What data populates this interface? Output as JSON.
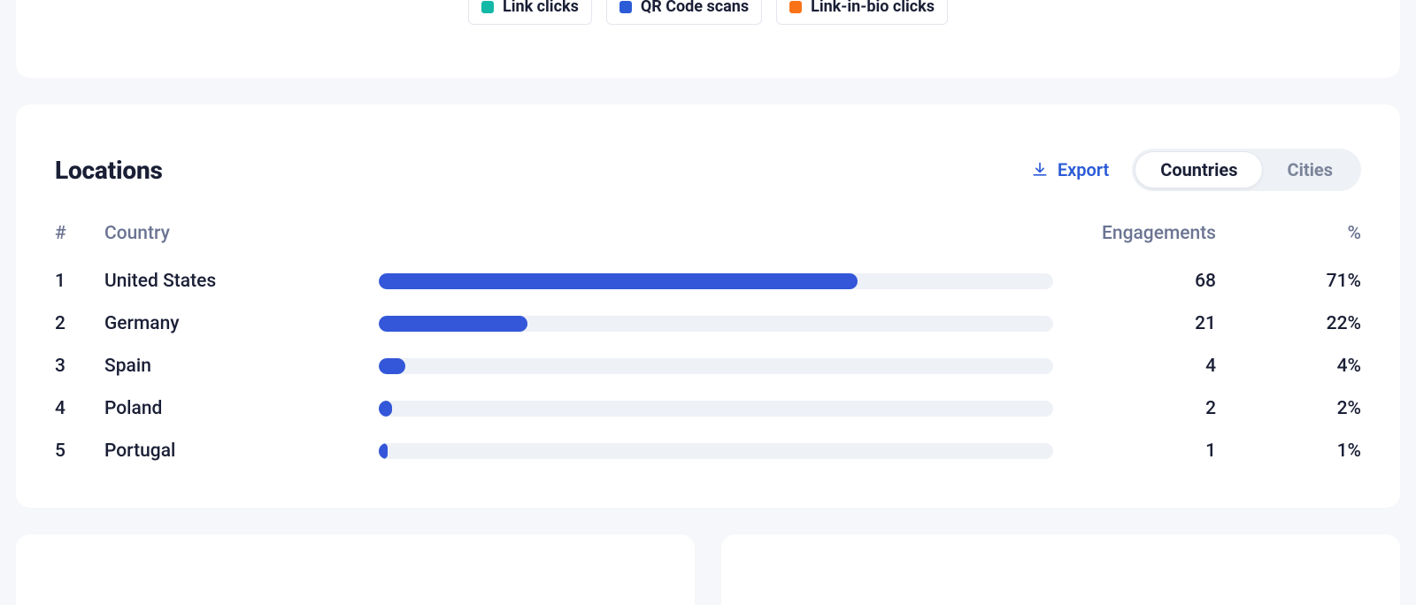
{
  "legend": {
    "items": [
      {
        "label": "Link clicks",
        "swatch": "teal"
      },
      {
        "label": "QR Code scans",
        "swatch": "blue"
      },
      {
        "label": "Link-in-bio clicks",
        "swatch": "orange"
      }
    ]
  },
  "locations": {
    "title": "Locations",
    "export_label": "Export",
    "tabs": {
      "countries": "Countries",
      "cities": "Cities",
      "active": "countries"
    },
    "columns": {
      "rank": "#",
      "country": "Country",
      "engagements": "Engagements",
      "pct": "%"
    },
    "rows": [
      {
        "rank": "1",
        "country": "United States",
        "engagements": "68",
        "pct": "71%",
        "bar_pct": 71
      },
      {
        "rank": "2",
        "country": "Germany",
        "engagements": "21",
        "pct": "22%",
        "bar_pct": 22
      },
      {
        "rank": "3",
        "country": "Spain",
        "engagements": "4",
        "pct": "4%",
        "bar_pct": 4
      },
      {
        "rank": "4",
        "country": "Poland",
        "engagements": "2",
        "pct": "2%",
        "bar_pct": 2
      },
      {
        "rank": "5",
        "country": "Portugal",
        "engagements": "1",
        "pct": "1%",
        "bar_pct": 1
      }
    ]
  },
  "chart_data": {
    "type": "bar",
    "title": "Locations",
    "xlabel": "Country",
    "ylabel": "Engagements",
    "categories": [
      "United States",
      "Germany",
      "Spain",
      "Poland",
      "Portugal"
    ],
    "values": [
      68,
      21,
      4,
      2,
      1
    ],
    "percent": [
      71,
      22,
      4,
      2,
      1
    ],
    "ylim": [
      0,
      100
    ]
  }
}
